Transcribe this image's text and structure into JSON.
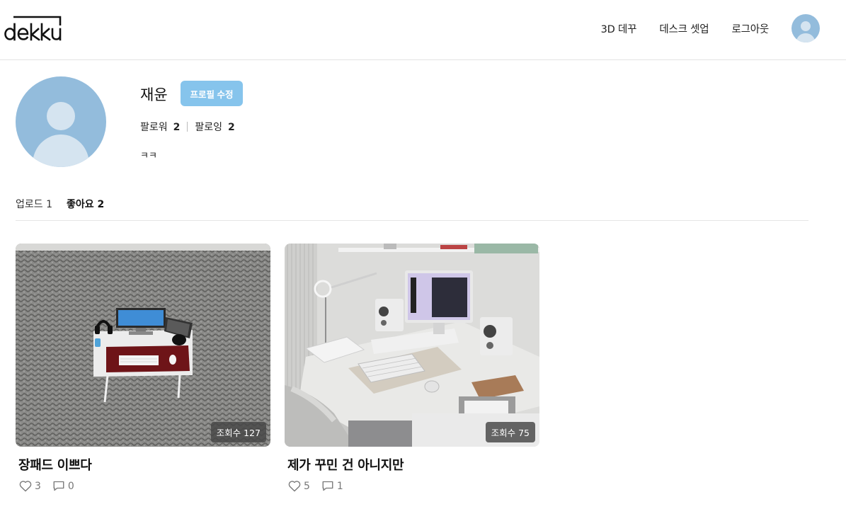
{
  "header": {
    "logo_text": "dekku",
    "nav": [
      "3D 데꾸",
      "데스크 셋업",
      "로그아웃"
    ]
  },
  "profile": {
    "name": "재윤",
    "edit_label": "프로필 수정",
    "followers_label": "팔로워",
    "followers_count": "2",
    "following_label": "팔로잉",
    "following_count": "2",
    "bio": "ㅋㅋ"
  },
  "tabs": [
    {
      "label": "업로드 1",
      "active": false
    },
    {
      "label": "좋아요 2",
      "active": true
    }
  ],
  "posts": [
    {
      "title": "장패드 이쁘다",
      "views": "조회수 127",
      "likes": "3",
      "comments": "0"
    },
    {
      "title": "제가 꾸민 건 아니지만",
      "views": "조회수 75",
      "likes": "5",
      "comments": "1"
    }
  ],
  "colors": {
    "accent": "#86c4ec",
    "avatar_bg": "#93bcdc"
  }
}
